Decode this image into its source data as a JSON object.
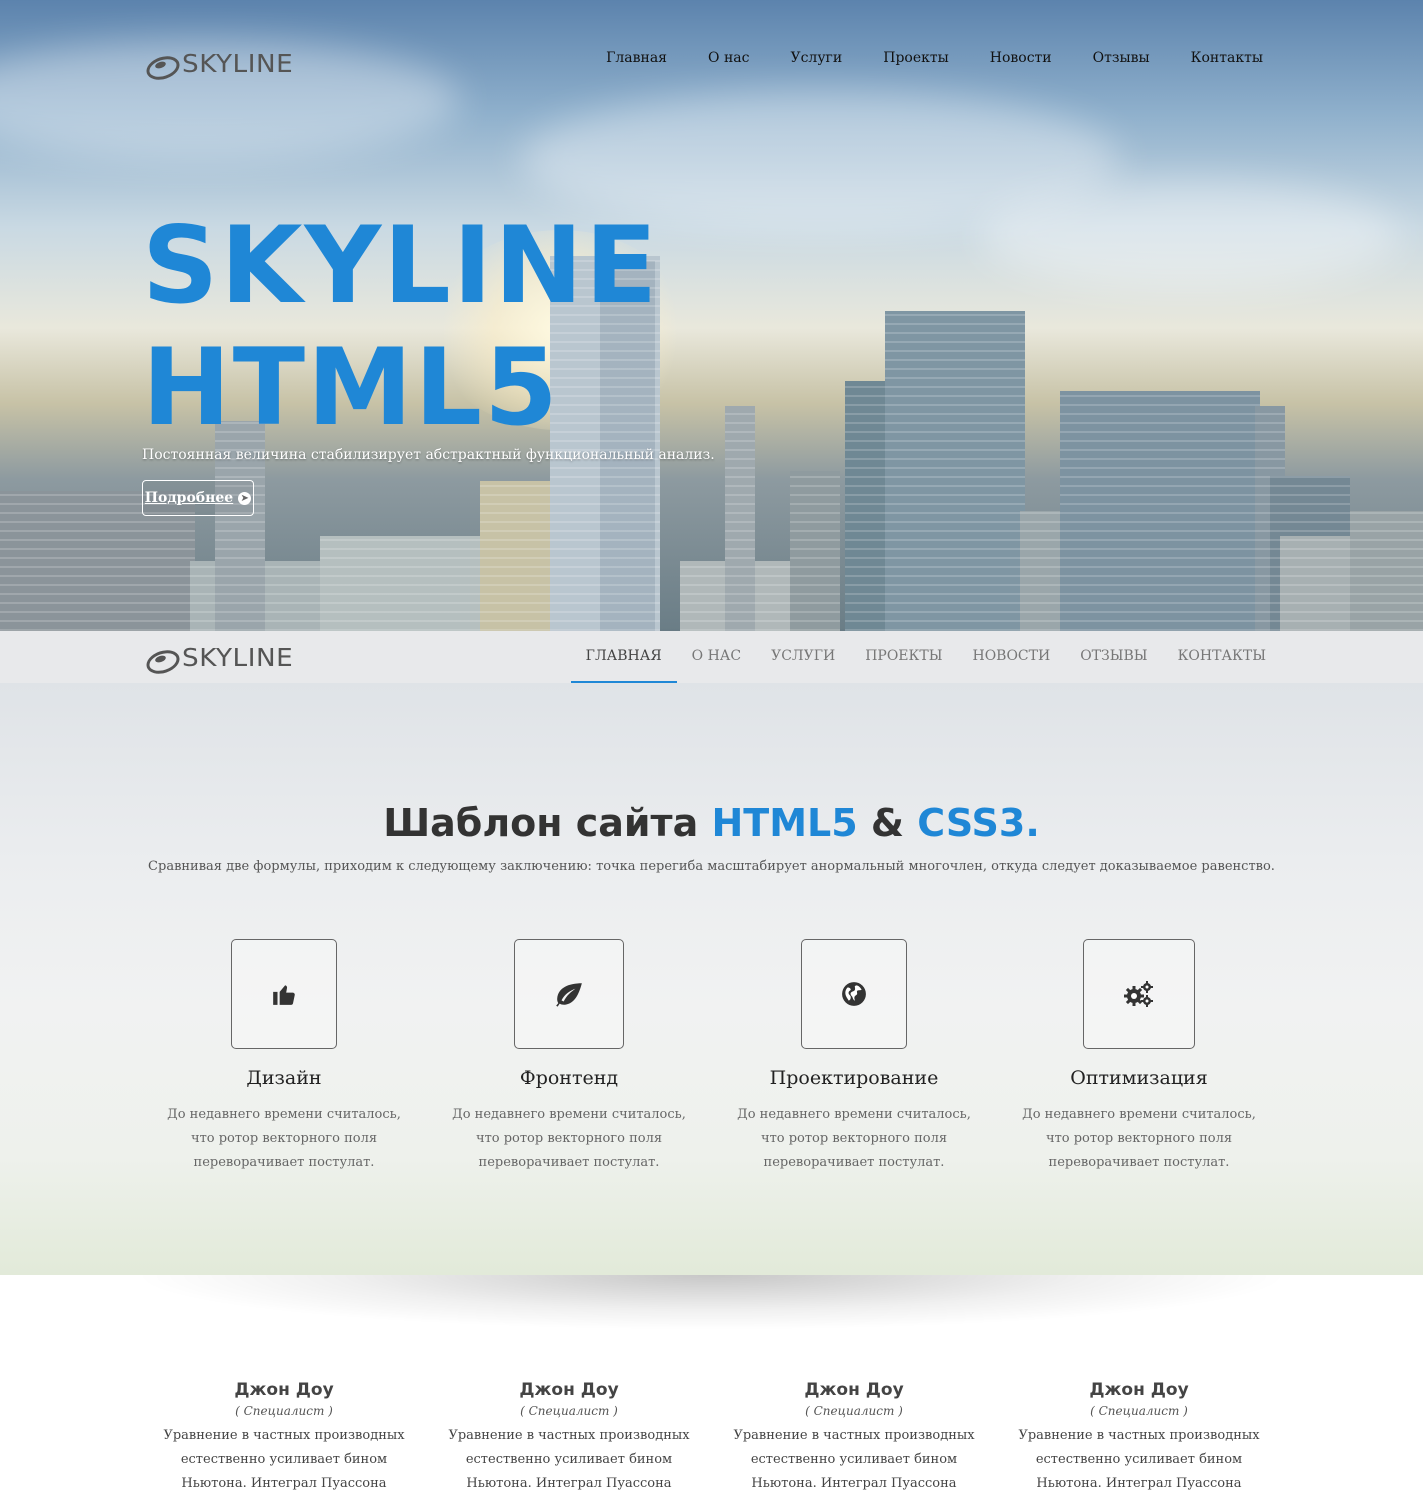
{
  "brand": {
    "logo_text": "SKYLINE"
  },
  "top_nav": [
    "Главная",
    "О нас",
    "Услуги",
    "Проекты",
    "Новости",
    "Отзывы",
    "Контакты"
  ],
  "hero": {
    "title_line1": "SKYLINE",
    "title_line2": "HTML5",
    "subtitle": "Постоянная величина стабилизирует абстрактный функциональный анализ.",
    "button_label": "Подробнее"
  },
  "main_nav": {
    "items": [
      "Главная",
      "О нас",
      "Услуги",
      "Проекты",
      "Новости",
      "Отзывы",
      "Контакты"
    ],
    "active_index": 0
  },
  "features": {
    "title_prefix": "Шаблон сайта",
    "title_html5": "HTML5",
    "title_amp": "&",
    "title_css3": "CSS3.",
    "subtitle": "Сравнивая две формулы, приходим к следующему заключению: точка перегиба масштабирует анормальный многочлен, откуда следует доказываемое равенство.",
    "items": [
      {
        "icon": "thumbs-up-icon",
        "title": "Дизайн",
        "text": "До недавнего времени считалось, что ротор векторного поля переворачивает постулат."
      },
      {
        "icon": "leaf-icon",
        "title": "Фронтенд",
        "text": "До недавнего времени считалось, что ротор векторного поля переворачивает постулат."
      },
      {
        "icon": "globe-icon",
        "title": "Проектирование",
        "text": "До недавнего времени считалось, что ротор векторного поля переворачивает постулат."
      },
      {
        "icon": "gears-icon",
        "title": "Оптимизация",
        "text": "До недавнего времени считалось, что ротор векторного поля переворачивает постулат."
      }
    ]
  },
  "team": [
    {
      "name": "Джон Доу",
      "role": "( Специалист )",
      "text": "Уравнение в частных производных естественно усиливает бином Ньютона. Интеграл Пуассона обуславливает"
    },
    {
      "name": "Джон Доу",
      "role": "( Специалист )",
      "text": "Уравнение в частных производных естественно усиливает бином Ньютона. Интеграл Пуассона обуславливает"
    },
    {
      "name": "Джон Доу",
      "role": "( Специалист )",
      "text": "Уравнение в частных производных естественно усиливает бином Ньютона. Интеграл Пуассона обуславливает"
    },
    {
      "name": "Джон Доу",
      "role": "( Специалист )",
      "text": "Уравнение в частных производных естественно усиливает бином Ньютона. Интеграл Пуассона обуславливает"
    }
  ],
  "colors": {
    "accent": "#1f87d6",
    "heading": "#333333",
    "nav_bg": "#e8e9eb"
  }
}
